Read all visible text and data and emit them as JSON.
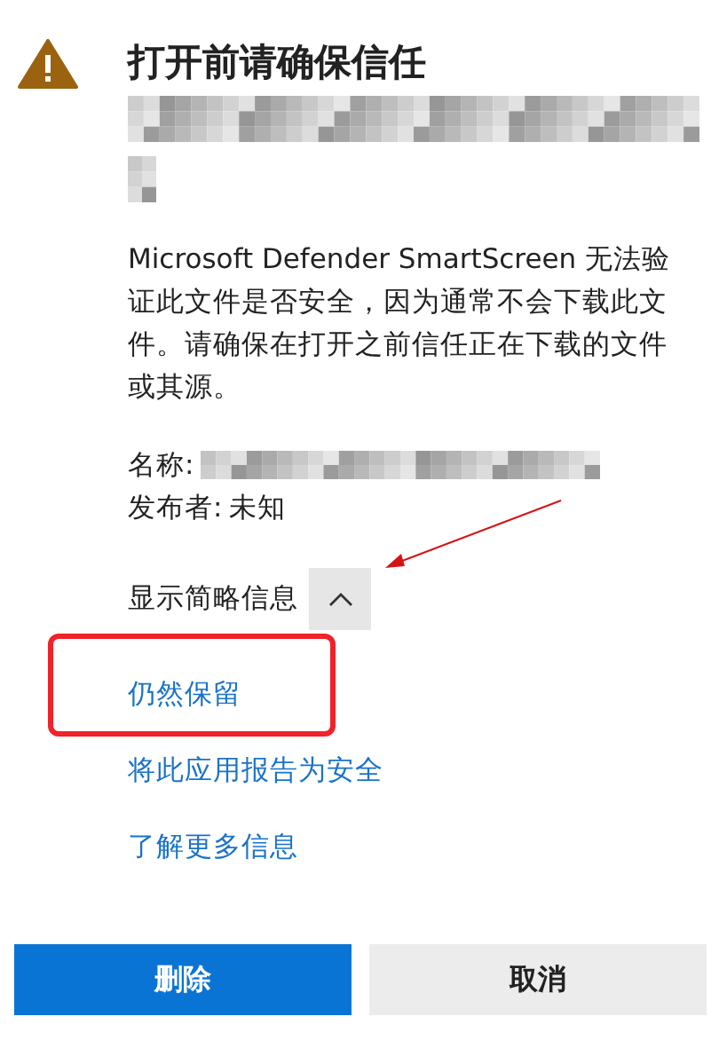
{
  "title": "打开前请确保信任",
  "description": "Microsoft Defender SmartScreen 无法验证此文件是否安全，因为通常不会下载此文件。请确保在打开之前信任正在下载的文件或其源。",
  "name_label": "名称:",
  "publisher_label": "发布者:",
  "publisher_value": "未知",
  "details_toggle": {
    "label": "显示简略信息",
    "expanded": true
  },
  "links": [
    "仍然保留",
    "将此应用报告为安全",
    "了解更多信息"
  ],
  "buttons": [
    {
      "label": "删除",
      "kind": "primary"
    },
    {
      "label": "取消",
      "kind": "secondary"
    }
  ]
}
